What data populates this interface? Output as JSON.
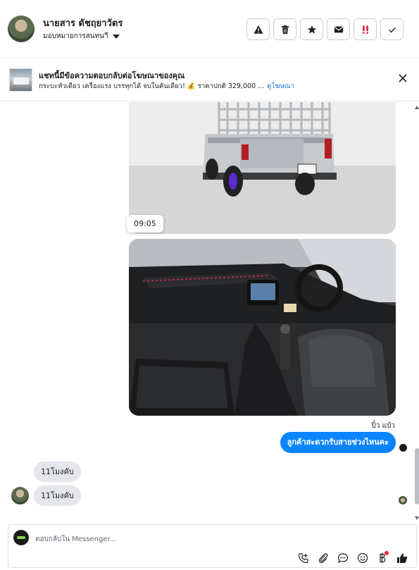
{
  "header": {
    "contact_name": "นายสาร ดัชฤยาวัตร",
    "assign_label": "มอบหมายการสนทนาี",
    "actions": [
      {
        "name": "report-button",
        "icon": "warning-icon"
      },
      {
        "name": "delete-button",
        "icon": "trash-icon"
      },
      {
        "name": "star-button",
        "icon": "star-icon"
      },
      {
        "name": "mark-unread-button",
        "icon": "envelope-icon"
      },
      {
        "name": "important-button",
        "icon": "exclamation-icon",
        "color": "#e41e3f"
      },
      {
        "name": "done-button",
        "icon": "check-icon"
      }
    ]
  },
  "banner": {
    "title": "แชทนี้มีข้อความตอบกลับต่อโฆษณาของคุณ",
    "text": "กระบะหัวเดียว เครื่องแรง บรรทุกได้ จบในคันเดียว! 💰 ราคาปกติ 329,000 ...",
    "link": "ดูโฆษณา"
  },
  "chat": {
    "time_chip": "09:05",
    "sender_label": "ปิ๋ว แป๋ว",
    "outgoing_message": "ลูกค้าสะดวกรับสายช่วงไหนคะ",
    "incoming_messages": [
      "11โมงคับ",
      "11โมงคับ"
    ]
  },
  "composer": {
    "placeholder": "ตอบกลับใน Messenger..."
  },
  "colors": {
    "outgoing_bubble": "#0a84ff",
    "incoming_bubble": "#e4e6eb",
    "link": "#1a6ee6"
  }
}
